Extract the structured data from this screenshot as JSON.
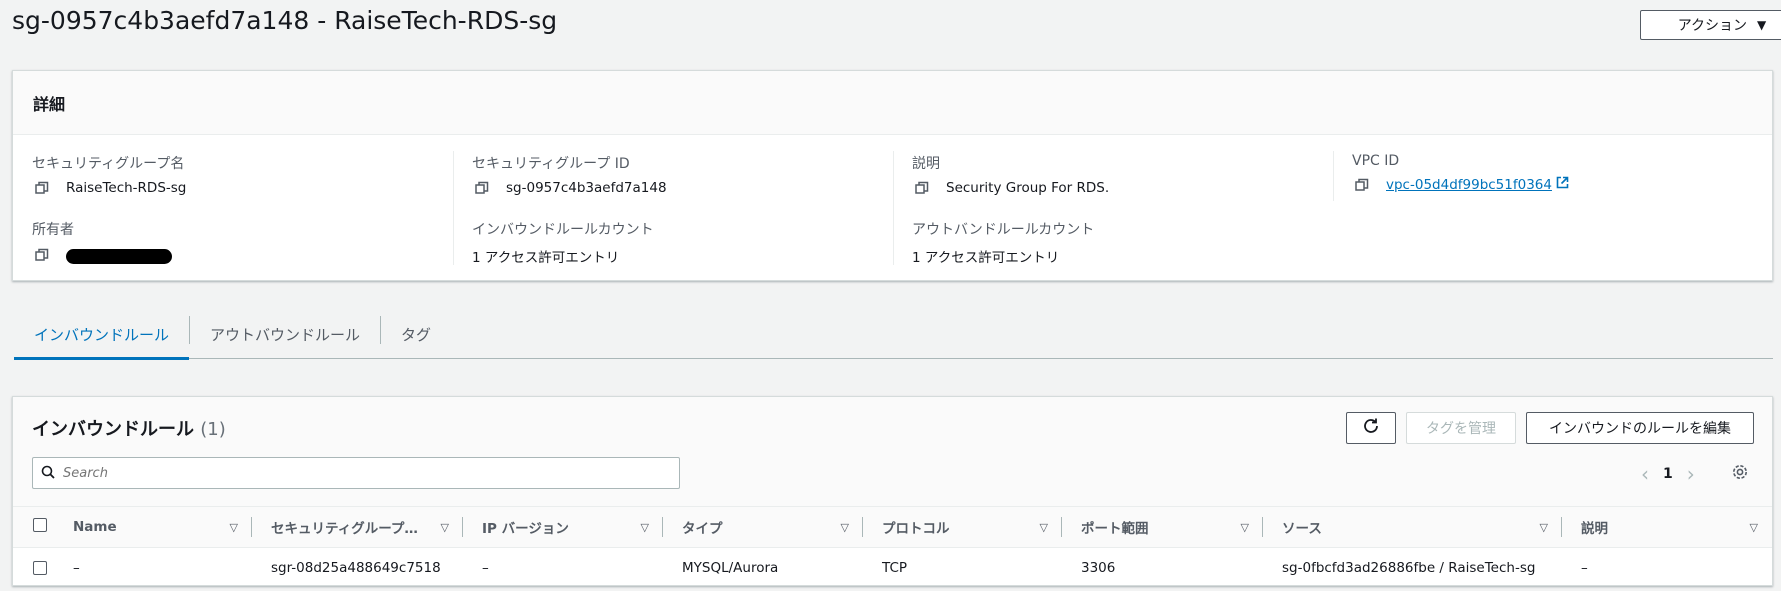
{
  "header": {
    "title": "sg-0957c4b3aefd7a148 - RaiseTech-RDS-sg",
    "actions_label": "アクション"
  },
  "details": {
    "heading": "詳細",
    "fields": [
      {
        "label": "セキュリティグループ名",
        "value": "RaiseTech-RDS-sg"
      },
      {
        "label": "セキュリティグループ ID",
        "value": "sg-0957c4b3aefd7a148"
      },
      {
        "label": "説明",
        "value": "Security Group For RDS."
      },
      {
        "label": "VPC ID",
        "value": "vpc-05d4df99bc51f0364"
      },
      {
        "label": "所有者",
        "value": ""
      },
      {
        "label": "インバウンドルールカウント",
        "value": "1 アクセス許可エントリ"
      },
      {
        "label": "アウトバンドルールカウント",
        "value": "1 アクセス許可エントリ"
      }
    ]
  },
  "tabs": [
    {
      "label": "インバウンドルール",
      "active": true
    },
    {
      "label": "アウトバウンドルール",
      "active": false
    },
    {
      "label": "タグ",
      "active": false
    }
  ],
  "rules": {
    "title": "インバウンドルール",
    "count": "(1)",
    "manage_tags_label": "タグを管理",
    "edit_rules_label": "インバウンドのルールを編集",
    "search_placeholder": "Search",
    "page": "1",
    "columns": [
      "Name",
      "セキュリティグループ…",
      "IP バージョン",
      "タイプ",
      "プロトコル",
      "ポート範囲",
      "ソース",
      "説明"
    ],
    "rows": [
      [
        "–",
        "sgr-08d25a488649c7518",
        "–",
        "MYSQL/Aurora",
        "TCP",
        "3306",
        "sg-0fbcfd3ad26886fbe / RaiseTech-sg",
        "–"
      ]
    ]
  },
  "colors": {
    "accent": "#0073bb",
    "text": "#16191f",
    "muted": "#545b64",
    "background": "#f2f3f3"
  },
  "icons": [
    "copy-icon",
    "external-link-icon",
    "refresh-icon",
    "search-icon",
    "chevron-left-icon",
    "chevron-right-icon",
    "settings-icon",
    "sort-caret-icon"
  ]
}
